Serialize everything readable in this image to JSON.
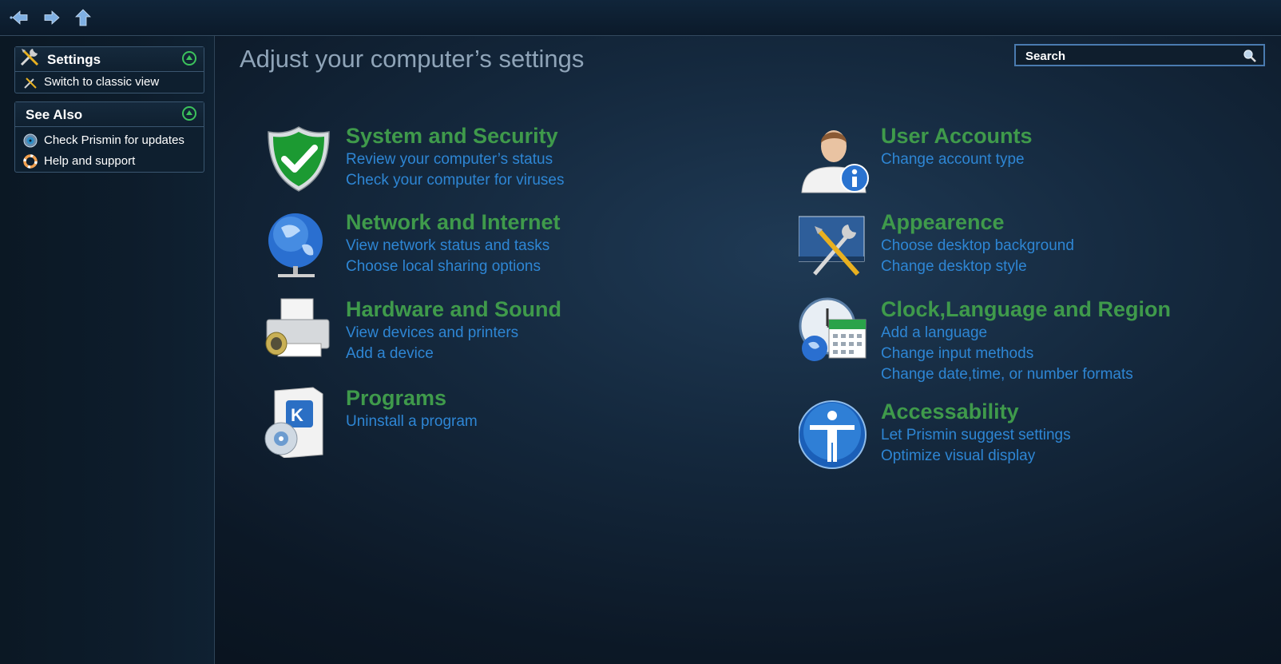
{
  "toolbar": {
    "back_icon": "back-arrow-icon",
    "forward_icon": "forward-arrow-icon",
    "up_icon": "up-arrow-icon"
  },
  "sidebar": {
    "settings_panel": {
      "title": "Settings",
      "items": [
        {
          "label": "Switch to classic view",
          "icon": "tools-icon"
        }
      ]
    },
    "see_also_panel": {
      "title": "See Also",
      "items": [
        {
          "label": "Check Prismin for updates",
          "icon": "update-disc-icon"
        },
        {
          "label": "Help and support",
          "icon": "lifebuoy-icon"
        }
      ]
    }
  },
  "main": {
    "title": "Adjust your computer’s settings",
    "search": {
      "placeholder": "Search"
    },
    "categories": [
      {
        "title": "System and Security",
        "icon": "shield-check-icon",
        "links": [
          "Review your computer’s status",
          "Check your computer for viruses"
        ]
      },
      {
        "title": "Network and Internet",
        "icon": "globe-network-icon",
        "links": [
          "View network status and tasks",
          "Choose local sharing options"
        ]
      },
      {
        "title": "Hardware and Sound",
        "icon": "printer-speaker-icon",
        "links": [
          "View devices and printers",
          "Add a device"
        ]
      },
      {
        "title": "Programs",
        "icon": "software-box-icon",
        "links": [
          "Uninstall a program"
        ]
      },
      {
        "title": "User Accounts",
        "icon": "user-info-icon",
        "links": [
          "Change account type"
        ]
      },
      {
        "title": "Appearence",
        "icon": "desktop-tools-icon",
        "links": [
          "Choose desktop background",
          "Change desktop style"
        ]
      },
      {
        "title": "Clock,Language and Region",
        "icon": "clock-calendar-globe-icon",
        "links": [
          "Add a language",
          "Change input methods",
          "Change date,time, or number formats"
        ]
      },
      {
        "title": "Accessability",
        "icon": "accessibility-person-icon",
        "links": [
          "Let Prismin suggest settings",
          "Optimize visual display"
        ]
      }
    ]
  },
  "colors": {
    "category_title": "#3f9a4b",
    "link": "#2e86d4",
    "page_title": "#8fa4b8",
    "collapse_button": "#3cc25c"
  }
}
